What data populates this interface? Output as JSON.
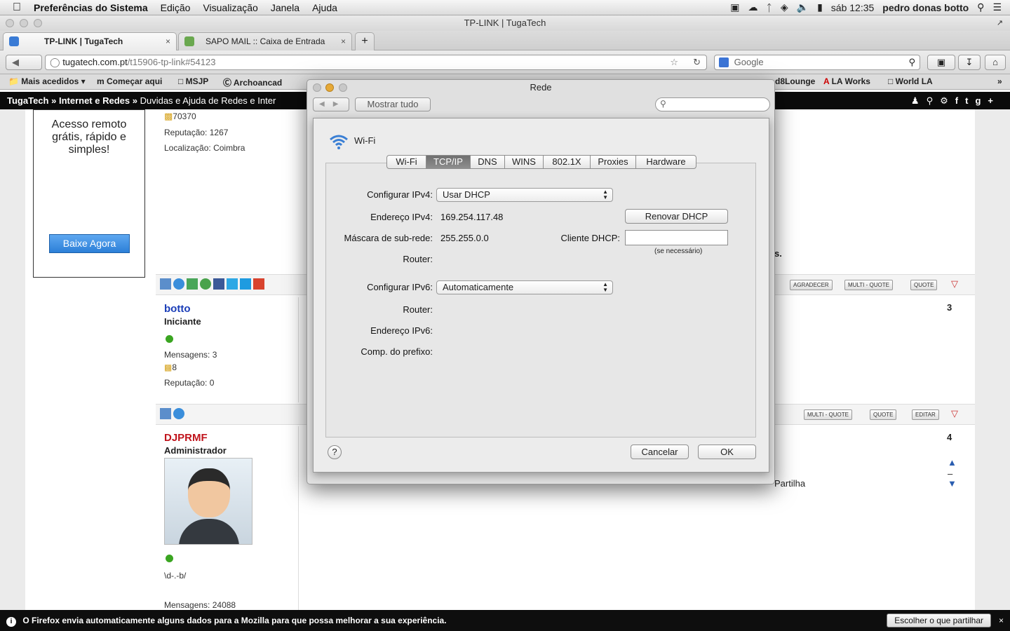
{
  "menubar": {
    "app": "Preferências do Sistema",
    "items": [
      "Edição",
      "Visualização",
      "Janela",
      "Ajuda"
    ],
    "clock": "sáb 12:35",
    "user": "pedro donas botto"
  },
  "window_title": "TP-LINK | TugaTech",
  "tabs": [
    {
      "label": "TP-LINK | TugaTech",
      "close": "×"
    },
    {
      "label": "SAPO MAIL :: Caixa de Entrada",
      "close": "×"
    }
  ],
  "new_tab": "+",
  "url": {
    "host": "tugatech.com.pt",
    "path": "/t15906-tp-link#54123"
  },
  "search": {
    "placeholder": "Google"
  },
  "bookmarks": [
    "Mais acedidos ▾",
    "Começar aqui",
    "MSJP",
    "Archoancad",
    "d8Lounge",
    "LA Works",
    "World LA"
  ],
  "site_nav": {
    "crumbs": [
      "TugaTech",
      "»",
      "Internet e Redes",
      "»",
      "Duvidas e Ajuda de Redes e Inter"
    ]
  },
  "ad": {
    "text": "Acesso remoto grátis, rápido e simples!",
    "button": "Baixe Agora"
  },
  "post1": {
    "count": "70370",
    "reputation_label": "Reputação:",
    "reputation": "1267",
    "location_label": "Localização:",
    "location": "Coimbra"
  },
  "post2": {
    "name": "botto",
    "rank": "Iniciante",
    "messages_label": "Mensagens:",
    "messages": "3",
    "count": "8",
    "reputation_label": "Reputação:",
    "reputation": "0",
    "number": "3"
  },
  "post3": {
    "name": "DJPRMF",
    "rank": "Administrador",
    "sig": "\\d-.-b/",
    "messages_label": "Mensagens:",
    "messages": "24088",
    "number": "4",
    "text_tail": "Partilha"
  },
  "post_buttons": {
    "thanks": "AGRADECER",
    "multiquote": "MULTI - QUOTE",
    "quote": "QUOTE",
    "edit": "EDITAR"
  },
  "behind": {
    "suffix": "s."
  },
  "firefox_bar": {
    "message": "O Firefox envia automaticamente alguns dados para a Mozilla para que possa melhorar a sua experiência.",
    "button": "Escolher o que partilhar"
  },
  "dialog": {
    "title": "Rede",
    "show_all": "Mostrar tudo",
    "iface": "Wi-Fi",
    "tabs": [
      "Wi-Fi",
      "TCP/IP",
      "DNS",
      "WINS",
      "802.1X",
      "Proxies",
      "Hardware"
    ],
    "selected_tab": "TCP/IP",
    "ipv4_config_label": "Configurar IPv4:",
    "ipv4_config": "Usar DHCP",
    "ipv4_addr_label": "Endereço IPv4:",
    "ipv4_addr": "169.254.117.48",
    "renew": "Renovar DHCP",
    "mask_label": "Máscara de sub-rede:",
    "mask": "255.255.0.0",
    "dhcp_client_label": "Cliente DHCP:",
    "dhcp_client_value": "",
    "if_needed": "(se necessário)",
    "router_label": "Router:",
    "ipv6_config_label": "Configurar IPv6:",
    "ipv6_config": "Automaticamente",
    "router6_label": "Router:",
    "ipv6_addr_label": "Endereço IPv6:",
    "prefix_label": "Comp. do prefixo:",
    "help": "?",
    "cancel": "Cancelar",
    "ok": "OK"
  },
  "colors": {
    "accent_blue": "#1a3db8",
    "admin_red": "#c0141c",
    "selected_tab": "#7a7a7a"
  }
}
